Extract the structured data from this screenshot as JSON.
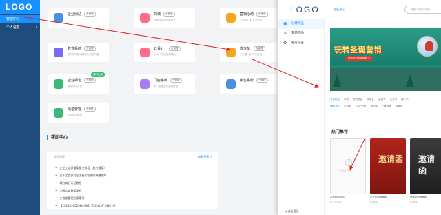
{
  "sidebar": {
    "logo": "LOGO",
    "items": [
      {
        "label": "管理中心",
        "active": true
      },
      {
        "label": "个人信息",
        "active": false
      }
    ]
  },
  "cards": [
    {
      "title": "企业网站",
      "tag": "去管理",
      "desc": "",
      "color": "#4a90e2"
    },
    {
      "title": "商城",
      "tag": "去管理",
      "desc": "轻松开启电商新模式",
      "color": "#ff6a88"
    },
    {
      "title": "营销活动",
      "tag": "去管理",
      "desc_prefix": "已创建：",
      "desc_value": "113",
      "desc_suffix": "进行中",
      "color": "#f5a623"
    },
    {
      "title": "教育系统",
      "tag": "去管理",
      "desc": "助力教培机构数字化转型升级",
      "color": "#7b6cf6"
    },
    {
      "title": "云设计",
      "tag": "去管理",
      "desc": "10W+在线海报模板",
      "color": "#ff6a88"
    },
    {
      "title": "微传单",
      "tag": "去管理",
      "desc_prefix": "已创建：",
      "desc_value": "219",
      "desc_suffix": "已发布",
      "color": "#f5a623"
    },
    {
      "title": "企业邮箱",
      "tag": "去管理",
      "tag2": "限时免费",
      "desc": "高效协同办公",
      "color": "#3cb878"
    },
    {
      "title": "门店系统",
      "tag": "去管理",
      "desc": "多门店连锁全渠道管理",
      "color": "#a57cf2"
    },
    {
      "title": "销售系统",
      "tag": "去管理",
      "desc": "",
      "color": "#4a90e2"
    },
    {
      "title": "域名管理",
      "tag": "去管理",
      "desc": "购买域名解析",
      "color": "#3cb878"
    }
  ],
  "help": {
    "heading": "帮助中心",
    "subheading": "常见问题",
    "more": "查看更多 >",
    "questions": [
      "企业工信部备案提交教程（集方备案）",
      "关于工信部对全国备案管理的调整通知",
      "域名实名认证教程",
      "全国公安备案流程",
      "工信部备案注意事项",
      "【2021031629新功能】\"我的素材\"功能介绍"
    ]
  },
  "panel": {
    "logo": "LOGO",
    "tab": "模板中心",
    "search_placeholder": "请输入关键字搜索",
    "nav": [
      {
        "label": "创建作品",
        "icon": "create-icon",
        "active": true
      },
      {
        "label": "我的作品",
        "icon": "user-icon",
        "active": false
      },
      {
        "label": "账号设置",
        "icon": "settings-icon",
        "active": false
      }
    ],
    "exit": "退出登录",
    "banner": {
      "title": "玩转圣诞营销",
      "subtitle": "含创意的圣诞模板 >"
    },
    "chip_rows": [
      [
        "节日热点",
        "年终",
        "年终总结",
        "平安夜",
        "圣诞节",
        "元旦节",
        "腊八节"
      ],
      [
        "爆款专区",
        "金马奖",
        "720°全景",
        "测试题",
        "一维投票",
        "球体投"
      ]
    ],
    "hot_heading": "热门推荐",
    "templates": [
      {
        "label": "从空白创建",
        "caption": "发现你的创意",
        "sub": "by Yourself",
        "style": "blank",
        "big": ""
      },
      {
        "label": "",
        "caption": "企业年中邀请函",
        "sub": "by 易展",
        "style": "red",
        "big": "邀请函"
      },
      {
        "label": "",
        "caption": "黑金年终邀请函",
        "sub": "by 易展",
        "style": "dark",
        "big": "邀请函"
      }
    ]
  }
}
